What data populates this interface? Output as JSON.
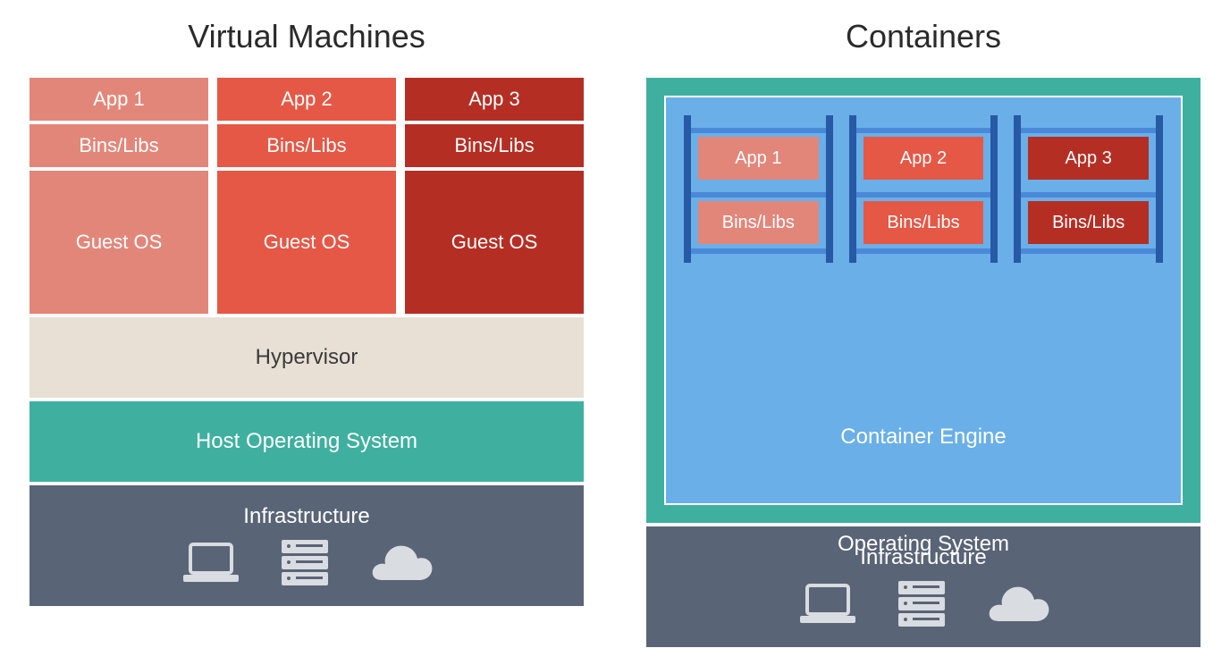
{
  "vm": {
    "title": "Virtual Machines",
    "cols": [
      {
        "app": "App 1",
        "libs": "Bins/Libs",
        "os": "Guest OS"
      },
      {
        "app": "App 2",
        "libs": "Bins/Libs",
        "os": "Guest OS"
      },
      {
        "app": "App 3",
        "libs": "Bins/Libs",
        "os": "Guest OS"
      }
    ],
    "hypervisor": "Hypervisor",
    "host_os": "Host Operating System",
    "infra": "Infrastructure"
  },
  "ct": {
    "title": "Containers",
    "cols": [
      {
        "app": "App 1",
        "libs": "Bins/Libs"
      },
      {
        "app": "App 2",
        "libs": "Bins/Libs"
      },
      {
        "app": "App 3",
        "libs": "Bins/Libs"
      }
    ],
    "engine": "Container Engine",
    "os": "Operating System",
    "infra": "Infrastructure"
  },
  "colors": {
    "red_light": "#e3867a",
    "red_med": "#e55846",
    "red_dark": "#b52e24",
    "teal": "#3fb0a0",
    "blue_light": "#6aafe8",
    "blue_dark": "#2759a4",
    "gray": "#5a6477",
    "beige": "#e8e0d5"
  }
}
